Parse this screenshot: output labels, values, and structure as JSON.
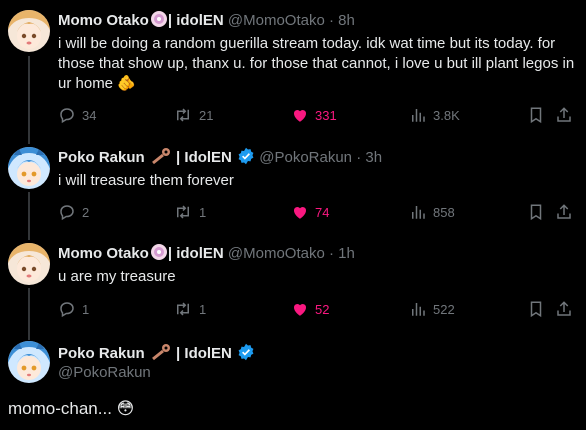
{
  "tweets": [
    {
      "name": "Momo Otako",
      "suffix": "| idolEN",
      "handle": "@MomoOtako",
      "time": "8h",
      "text": "i will be doing a random guerilla stream today. idk wat time but its today. for those that show up, thanx u. for those that cannot, i love u but ill plant legos in ur home 🫵",
      "replies": "34",
      "reposts": "21",
      "likes": "331",
      "views": "3.8K"
    },
    {
      "name": "Poko Rakun",
      "suffix": "| IdolEN",
      "handle": "@PokoRakun",
      "time": "3h",
      "text": "i will treasure them forever",
      "replies": "2",
      "reposts": "1",
      "likes": "74",
      "views": "858"
    },
    {
      "name": "Momo Otako",
      "suffix": "| idolEN",
      "handle": "@MomoOtako",
      "time": "1h",
      "text": "u are my treasure",
      "replies": "1",
      "reposts": "1",
      "likes": "52",
      "views": "522"
    }
  ],
  "main_tweet": {
    "name": "Poko Rakun",
    "suffix": "| IdolEN",
    "handle": "@PokoRakun",
    "text": "momo-chan... 😳"
  },
  "colors": {
    "background": "#000000",
    "text": "#e7e9ea",
    "secondary": "#71767b",
    "like": "#f91880",
    "verified": "#1d9bf0"
  }
}
